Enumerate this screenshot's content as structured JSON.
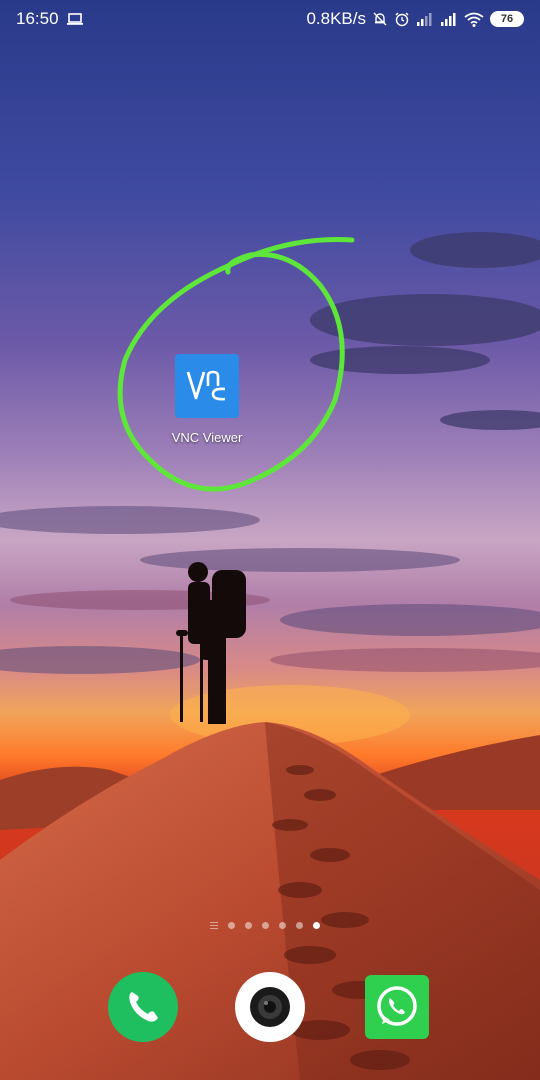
{
  "status_bar": {
    "time": "16:50",
    "network_speed": "0.8KB/s",
    "battery_level": "76",
    "icons": [
      "laptop-icon",
      "mute-bell-icon",
      "alarm-icon",
      "signal-icon",
      "signal-icon",
      "wifi-icon",
      "battery-icon"
    ]
  },
  "home_screen": {
    "apps": [
      {
        "label": "VNC Viewer",
        "icon": "vnc-viewer-icon",
        "color": "#2b8be8"
      }
    ],
    "annotation_color": "#5fe63a",
    "page_indicator": {
      "pages": 6,
      "active": 6
    }
  },
  "dock": {
    "apps": [
      {
        "name": "phone",
        "icon": "phone-icon",
        "color": "#1fbf5f"
      },
      {
        "name": "camera",
        "icon": "camera-icon",
        "color": "#ffffff"
      },
      {
        "name": "whatsapp",
        "icon": "whatsapp-icon",
        "color": "#2fcf4f"
      }
    ]
  }
}
